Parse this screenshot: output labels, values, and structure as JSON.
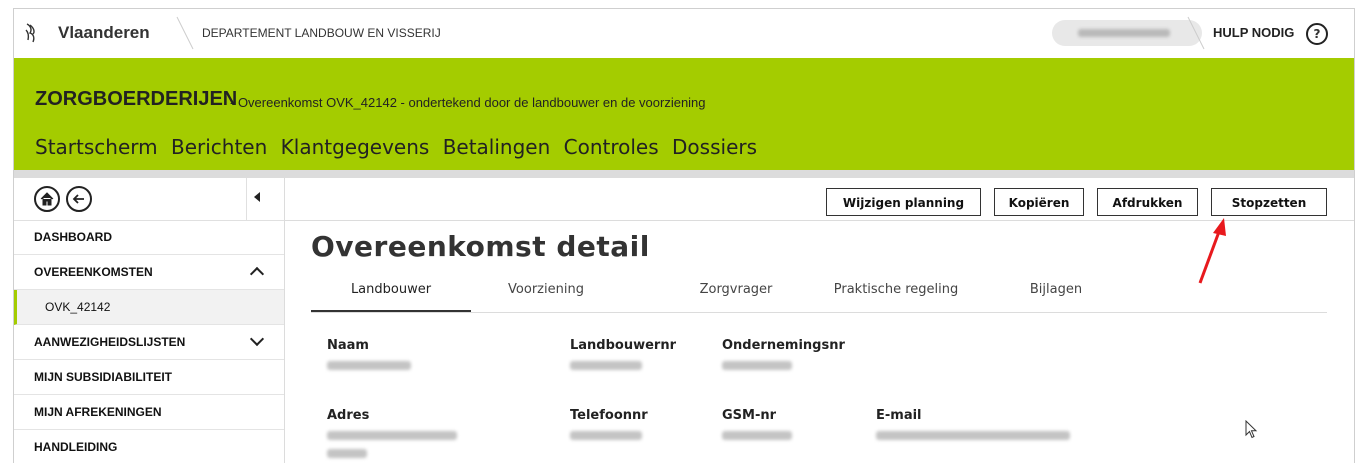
{
  "header": {
    "brand": "Vlaanderen",
    "department": "DEPARTEMENT LANDBOUW EN VISSERIJ",
    "help_label": "HULP NODIG",
    "help_icon": "?"
  },
  "banner": {
    "title": "ZORGBOERDERIJEN",
    "subtitle": "- Overeenkomst OVK_42142 - ondertekend door de landbouwer en de voorziening",
    "nav": [
      "Startscherm",
      "Berichten",
      "Klantgegevens",
      "Betalingen",
      "Controles",
      "Dossiers"
    ]
  },
  "sidebar": {
    "items": [
      {
        "label": "DASHBOARD"
      },
      {
        "label": "OVEREENKOMSTEN"
      },
      {
        "label": "OVK_42142"
      },
      {
        "label": "AANWEZIGHEIDSLIJSTEN"
      },
      {
        "label": "MIJN SUBSIDIABILITEIT"
      },
      {
        "label": "MIJN AFREKENINGEN"
      },
      {
        "label": "HANDLEIDING"
      }
    ]
  },
  "actions": {
    "wijzigen": "Wijzigen planning",
    "kopieren": "Kopiëren",
    "afdrukken": "Afdrukken",
    "stopzetten": "Stopzetten"
  },
  "page": {
    "title": "Overeenkomst detail",
    "tabs": [
      "Landbouwer",
      "Voorziening",
      "Zorgvrager",
      "Praktische regeling",
      "Bijlagen"
    ],
    "active_tab": "Landbouwer"
  },
  "fields": {
    "naam": "Naam",
    "landbouwernr": "Landbouwernr",
    "ondernemingsnr": "Ondernemingsnr",
    "adres": "Adres",
    "telefoonnr": "Telefoonnr",
    "gsmnr": "GSM-nr",
    "email": "E-mail"
  },
  "colors": {
    "accent": "#a4cc00",
    "annotation_arrow": "#e8191d"
  }
}
